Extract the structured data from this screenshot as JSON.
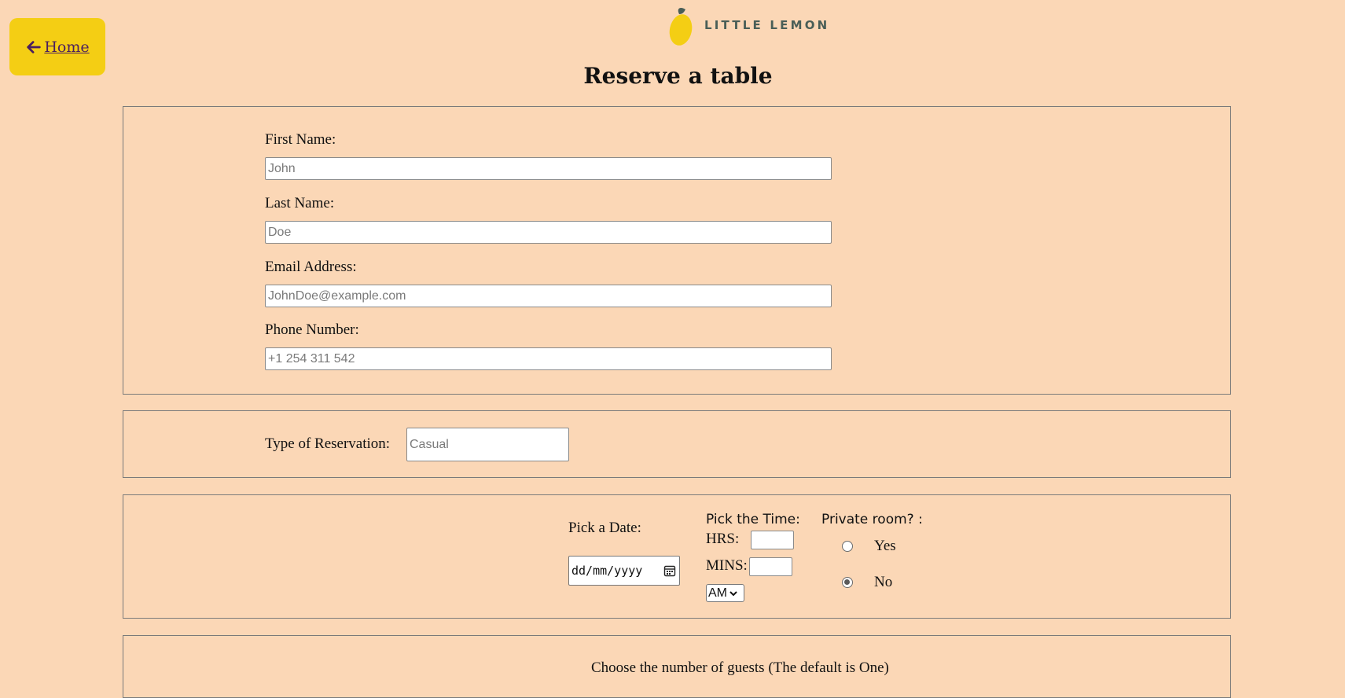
{
  "nav": {
    "home_label": "Home",
    "icons": {
      "back": "arrow-left-icon"
    }
  },
  "brand": {
    "logo_text": "LITTLE LEMON",
    "accent": "#f4ce14",
    "primary": "#495e57",
    "background": "#fbd7b6"
  },
  "page": {
    "title": "Reserve a table"
  },
  "contact": {
    "first_name": {
      "label": "First Name:",
      "placeholder": "John",
      "value": ""
    },
    "last_name": {
      "label": "Last Name:",
      "placeholder": "Doe",
      "value": ""
    },
    "email": {
      "label": "Email Address:",
      "placeholder": "JohnDoe@example.com",
      "value": ""
    },
    "phone": {
      "label": "Phone Number:",
      "placeholder": "+1 254 311 542",
      "value": ""
    }
  },
  "reservation": {
    "type_label": "Type of Reservation:",
    "type_placeholder": "Casual",
    "type_value": ""
  },
  "datetime": {
    "date_label": "Pick a Date:",
    "date_placeholder": "dd/mm/yyyy",
    "time_label": "Pick the Time:",
    "hours_label": "HRS:",
    "minutes_label": "MINS:",
    "ampm_value": "AM",
    "private_label": "Private room? :",
    "private_options": [
      {
        "label": "Yes",
        "checked": false
      },
      {
        "label": "No",
        "checked": true
      }
    ]
  },
  "guests": {
    "label": "Choose the number of guests (The default is One)"
  }
}
